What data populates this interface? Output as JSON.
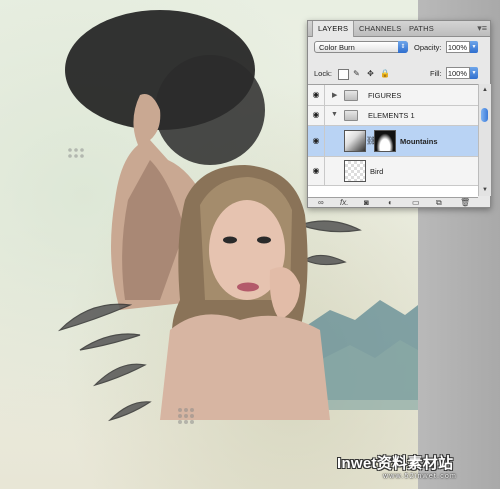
{
  "panel": {
    "tabs": [
      "LAYERS",
      "CHANNELS",
      "PATHS"
    ],
    "menu_icon": "panel-menu-icon",
    "blend_mode": "Color Burn",
    "opacity_label": "Opacity:",
    "opacity_value": "100%",
    "lock_label": "Lock:",
    "fill_label": "Fill:",
    "fill_value": "100%",
    "layers": [
      {
        "name": "FIGURES",
        "type": "group",
        "collapsed": true,
        "visible": true
      },
      {
        "name": "ELEMENTS 1",
        "type": "group",
        "collapsed": false,
        "visible": true
      },
      {
        "name": "Mountains",
        "type": "layer-with-mask",
        "selected": true,
        "visible": true
      },
      {
        "name": "Bird",
        "type": "layer",
        "visible": true
      }
    ],
    "footer_icons": [
      "link-icon",
      "fx-icon",
      "mask-icon",
      "adjustment-icon",
      "new-group-icon",
      "new-layer-icon",
      "trash-icon"
    ],
    "footer_fx_label": "fx."
  },
  "watermark": {
    "title": "Inwet资料素材站",
    "url": "www.52inwet.com"
  },
  "colors": {
    "selected_layer": "#b9d3f4",
    "accent_blue": "#3c7bd9",
    "canvas_gutter": "#ababab"
  }
}
